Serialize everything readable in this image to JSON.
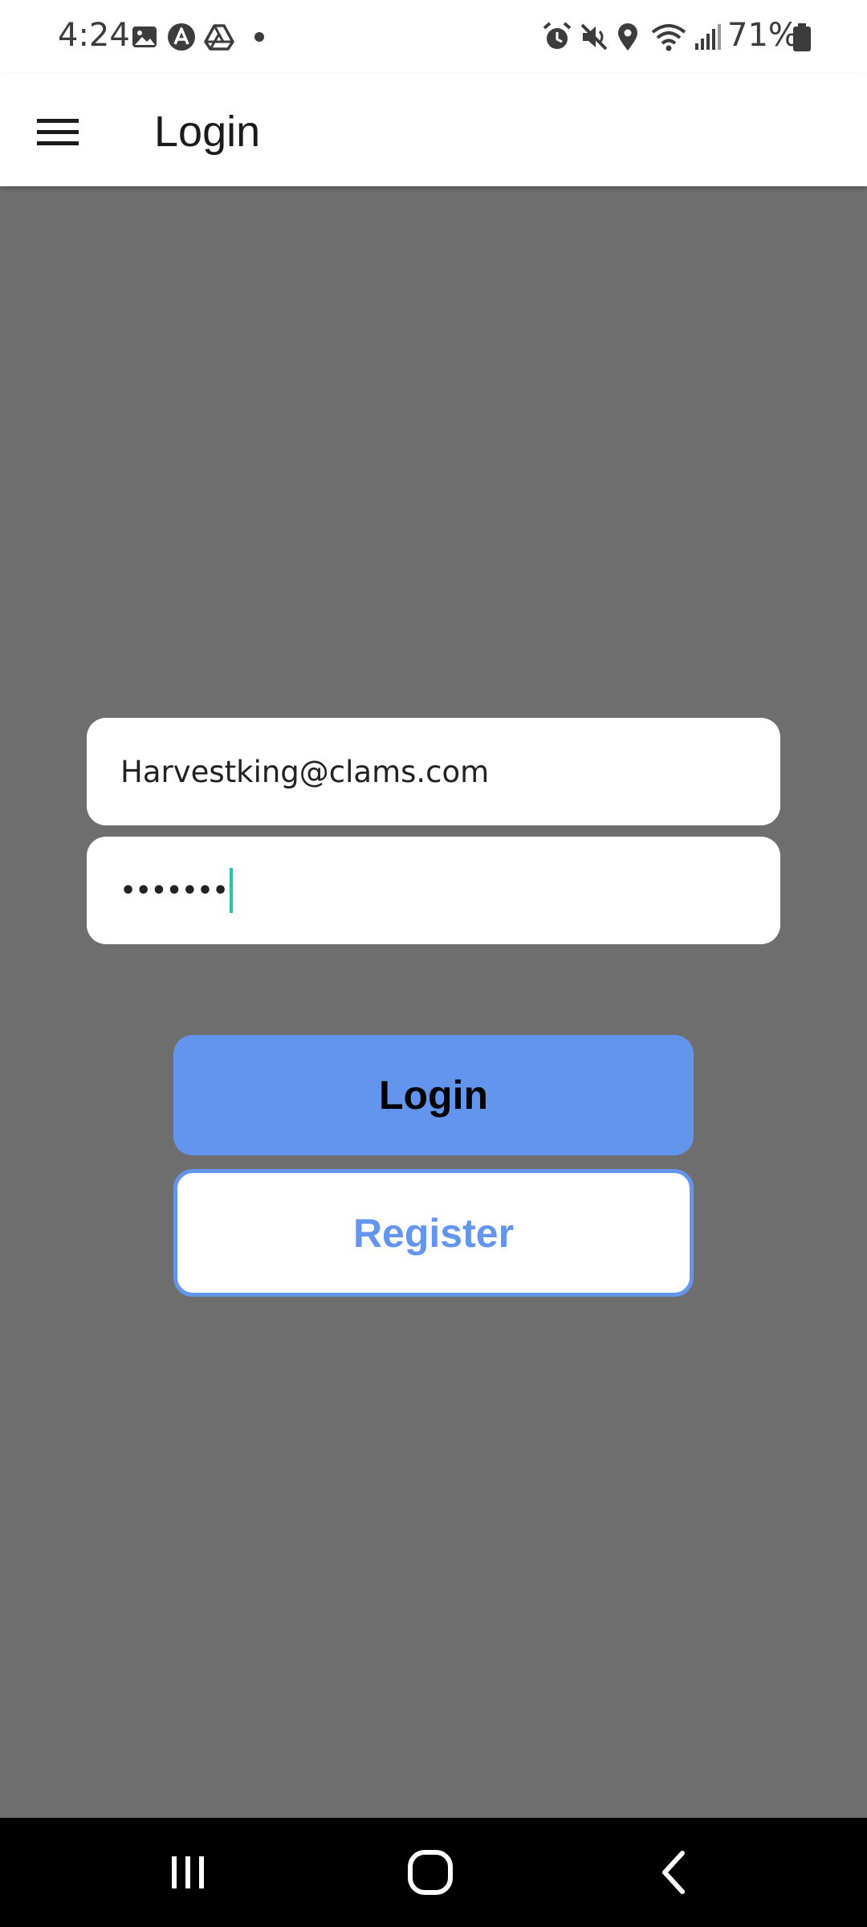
{
  "status_bar": {
    "time": "4:24",
    "battery": "71%",
    "left_icons": [
      "gallery-icon",
      "app-a-icon",
      "drive-icon",
      "dot-icon"
    ],
    "right_icons": [
      "alarm-icon",
      "mute-icon",
      "location-icon",
      "wifi-icon",
      "signal-icon",
      "battery-icon"
    ]
  },
  "app_bar": {
    "title": "Login",
    "menu_icon": "hamburger-menu-icon"
  },
  "form": {
    "email_value": "Harvestking@clams.com",
    "password_masked": "•••••••"
  },
  "buttons": {
    "login_label": "Login",
    "register_label": "Register"
  },
  "colors": {
    "background": "#6e6e6e",
    "accent": "#6495ed",
    "caret": "#1ec6b6"
  },
  "nav_bar": {
    "icons": [
      "recent-apps-icon",
      "home-icon",
      "back-icon"
    ]
  }
}
